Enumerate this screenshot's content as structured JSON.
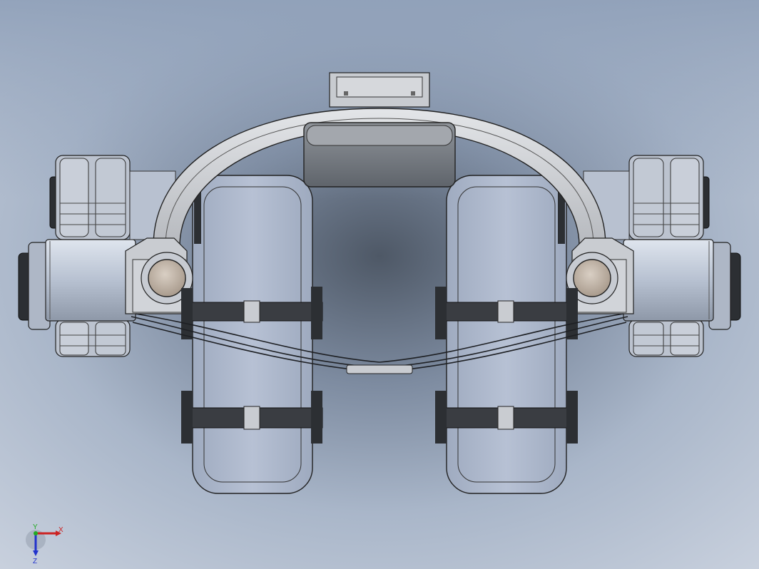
{
  "viewport": {
    "background_colors": [
      "#8e9fb8",
      "#b3bfd2",
      "#58626f",
      "#c9d1de",
      "#9aa7bd"
    ]
  },
  "triad": {
    "x_label": "X",
    "y_label": "Y",
    "z_label": "Z",
    "colors": {
      "x": "#cc2222",
      "y": "#22aa22",
      "z": "#2233cc"
    }
  },
  "model": {
    "part_colors": {
      "frame": "#c8cbd0",
      "pads": "#a8b3c8",
      "motor": "#b4bdcc",
      "lens": "#c2b6aa",
      "strap": "#3a3d42",
      "tire": "#2c2f33",
      "battery": "#7a7f86"
    }
  }
}
